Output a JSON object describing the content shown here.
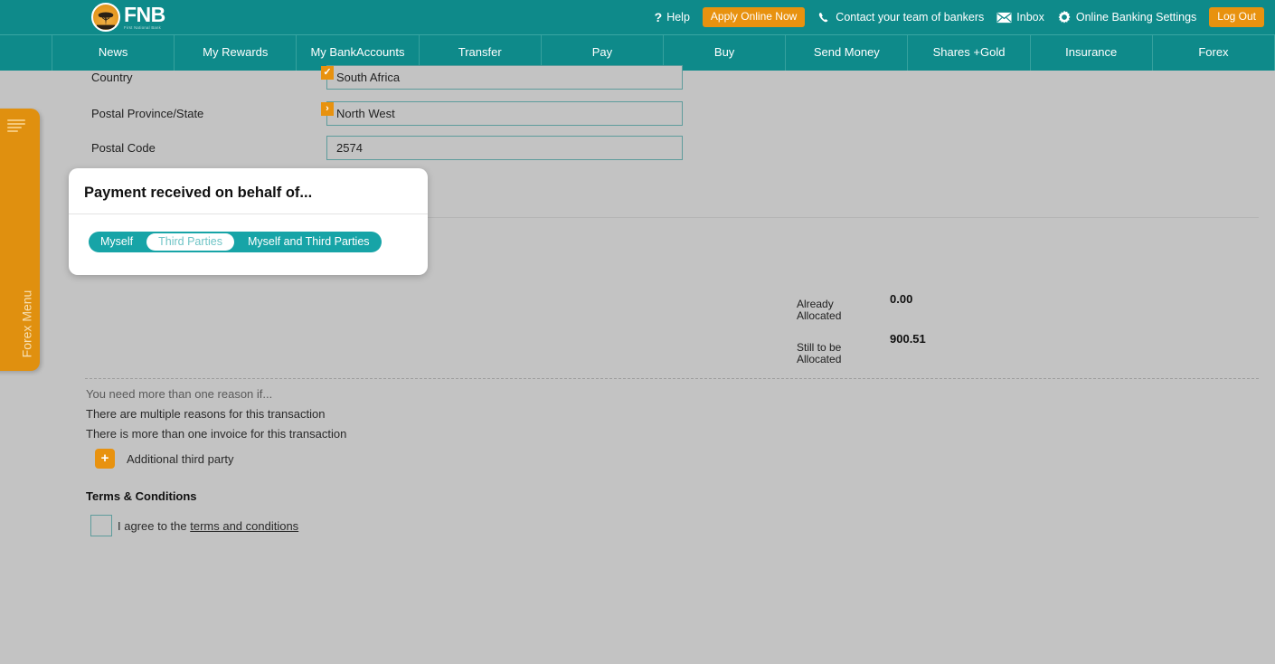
{
  "brand": {
    "logo_text": "FNB",
    "logo_sub": "First National Bank",
    "teal": "#0e8a8a",
    "orange": "#e8920f",
    "page_bg": "#c3c3c3"
  },
  "topbar": {
    "help_label": "Help",
    "apply_label": "Apply Online Now",
    "contact_label": "Contact your team of bankers",
    "inbox_label": "Inbox",
    "settings_label": "Online Banking Settings",
    "logout_label": "Log Out"
  },
  "nav": {
    "items": [
      {
        "label": "News"
      },
      {
        "label": "My Rewards"
      },
      {
        "label": "My Bank\nAccounts"
      },
      {
        "label": "Transfer"
      },
      {
        "label": "Pay"
      },
      {
        "label": "Buy"
      },
      {
        "label": "Send Money"
      },
      {
        "label": "Shares +\nGold"
      },
      {
        "label": "Insurance"
      },
      {
        "label": "Forex"
      }
    ]
  },
  "sidebar": {
    "forex_menu_label": "Forex Menu"
  },
  "form": {
    "fields": [
      {
        "label": "Country",
        "value": "South Africa",
        "badge": "✓",
        "has_badge": true
      },
      {
        "label": "Postal Province/State",
        "value": "North West",
        "badge": "›",
        "has_badge": true
      },
      {
        "label": "Postal Code",
        "value": "2574",
        "badge": "",
        "has_badge": false
      }
    ]
  },
  "popup": {
    "title": "Payment received on behalf of...",
    "options": [
      {
        "label": "Myself",
        "selected": false
      },
      {
        "label": "Third Parties",
        "selected": true
      },
      {
        "label": "Myself and Third Parties",
        "selected": false
      }
    ]
  },
  "allocation": {
    "already_label": "Already\nAllocated",
    "already_value": "0.00",
    "still_label": "Still to be\nAllocated",
    "still_value": "900.51"
  },
  "reasons": {
    "heading": "You need more than one reason if...",
    "line1": "There are multiple reasons for this transaction",
    "line2": "There is more than one invoice for this transaction",
    "add_label": "Additional third party",
    "add_icon": "+"
  },
  "terms": {
    "title": "Terms & Conditions",
    "agree_prefix": "I agree to the ",
    "link_label": "terms and conditions",
    "checked": false
  }
}
